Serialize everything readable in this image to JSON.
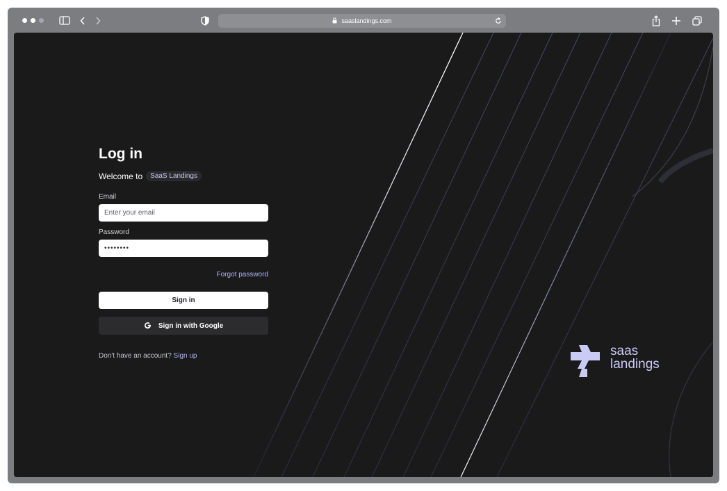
{
  "browser": {
    "url": "saaslandings.com",
    "icons": {
      "sidebar": "sidebar-icon",
      "back": "chevron-left-icon",
      "forward": "chevron-right-icon",
      "shield": "shield-icon",
      "lock": "lock-icon",
      "reload": "reload-icon",
      "share": "share-icon",
      "new_tab": "plus-icon",
      "tabs": "tabs-overview-icon"
    }
  },
  "login": {
    "title": "Log in",
    "welcome_prefix": "Welcome to",
    "brand_pill": "SaaS Landings",
    "email_label": "Email",
    "email_placeholder": "Enter your email",
    "password_label": "Password",
    "password_value": "••••••••",
    "forgot_password": "Forgot password",
    "sign_in_button": "Sign in",
    "google_button": "Sign in with Google",
    "google_icon": "google-g-icon",
    "signup_prompt": "Don't have an account?",
    "signup_link": "Sign up"
  },
  "brand": {
    "line1": "saas",
    "line2": "landings",
    "logo_icon": "saas-landings-logo-icon"
  },
  "colors": {
    "page_background": "#1a1a1b",
    "accent": "#aeb2f2",
    "brand": "#c9cbf5",
    "window_chrome": "#7b7d81"
  }
}
